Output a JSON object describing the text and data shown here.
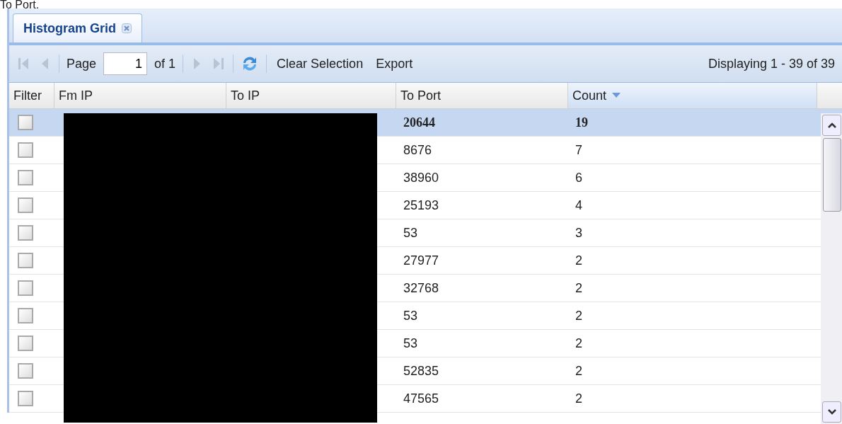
{
  "caption": "To Port.",
  "tab": {
    "label": "Histogram Grid",
    "selected": true
  },
  "toolbar": {
    "page_label": "Page",
    "page_value": "1",
    "page_of": "of 1",
    "actions": [
      "Clear Selection",
      "Export"
    ],
    "display_info": "Displaying 1 - 39 of 39"
  },
  "table": {
    "columns": [
      {
        "label": "Filter",
        "sorted": false
      },
      {
        "label": "Fm IP",
        "sorted": false
      },
      {
        "label": "To IP",
        "sorted": false
      },
      {
        "label": "To Port",
        "sorted": false
      },
      {
        "label": "Count",
        "sorted": true
      }
    ],
    "rows": [
      {
        "to_port": "20644",
        "count": "19",
        "checked": false,
        "selected": true
      },
      {
        "to_port": "8676",
        "count": "7",
        "checked": false,
        "selected": false
      },
      {
        "to_port": "38960",
        "count": "6",
        "checked": false,
        "selected": false
      },
      {
        "to_port": "25193",
        "count": "4",
        "checked": false,
        "selected": false
      },
      {
        "to_port": "53",
        "count": "3",
        "checked": false,
        "selected": false
      },
      {
        "to_port": "27977",
        "count": "2",
        "checked": false,
        "selected": false
      },
      {
        "to_port": "32768",
        "count": "2",
        "checked": false,
        "selected": false
      },
      {
        "to_port": "53",
        "count": "2",
        "checked": false,
        "selected": false
      },
      {
        "to_port": "53",
        "count": "2",
        "checked": false,
        "selected": false
      },
      {
        "to_port": "52835",
        "count": "2",
        "checked": false,
        "selected": false
      },
      {
        "to_port": "47565",
        "count": "2",
        "checked": false,
        "selected": false
      }
    ]
  }
}
